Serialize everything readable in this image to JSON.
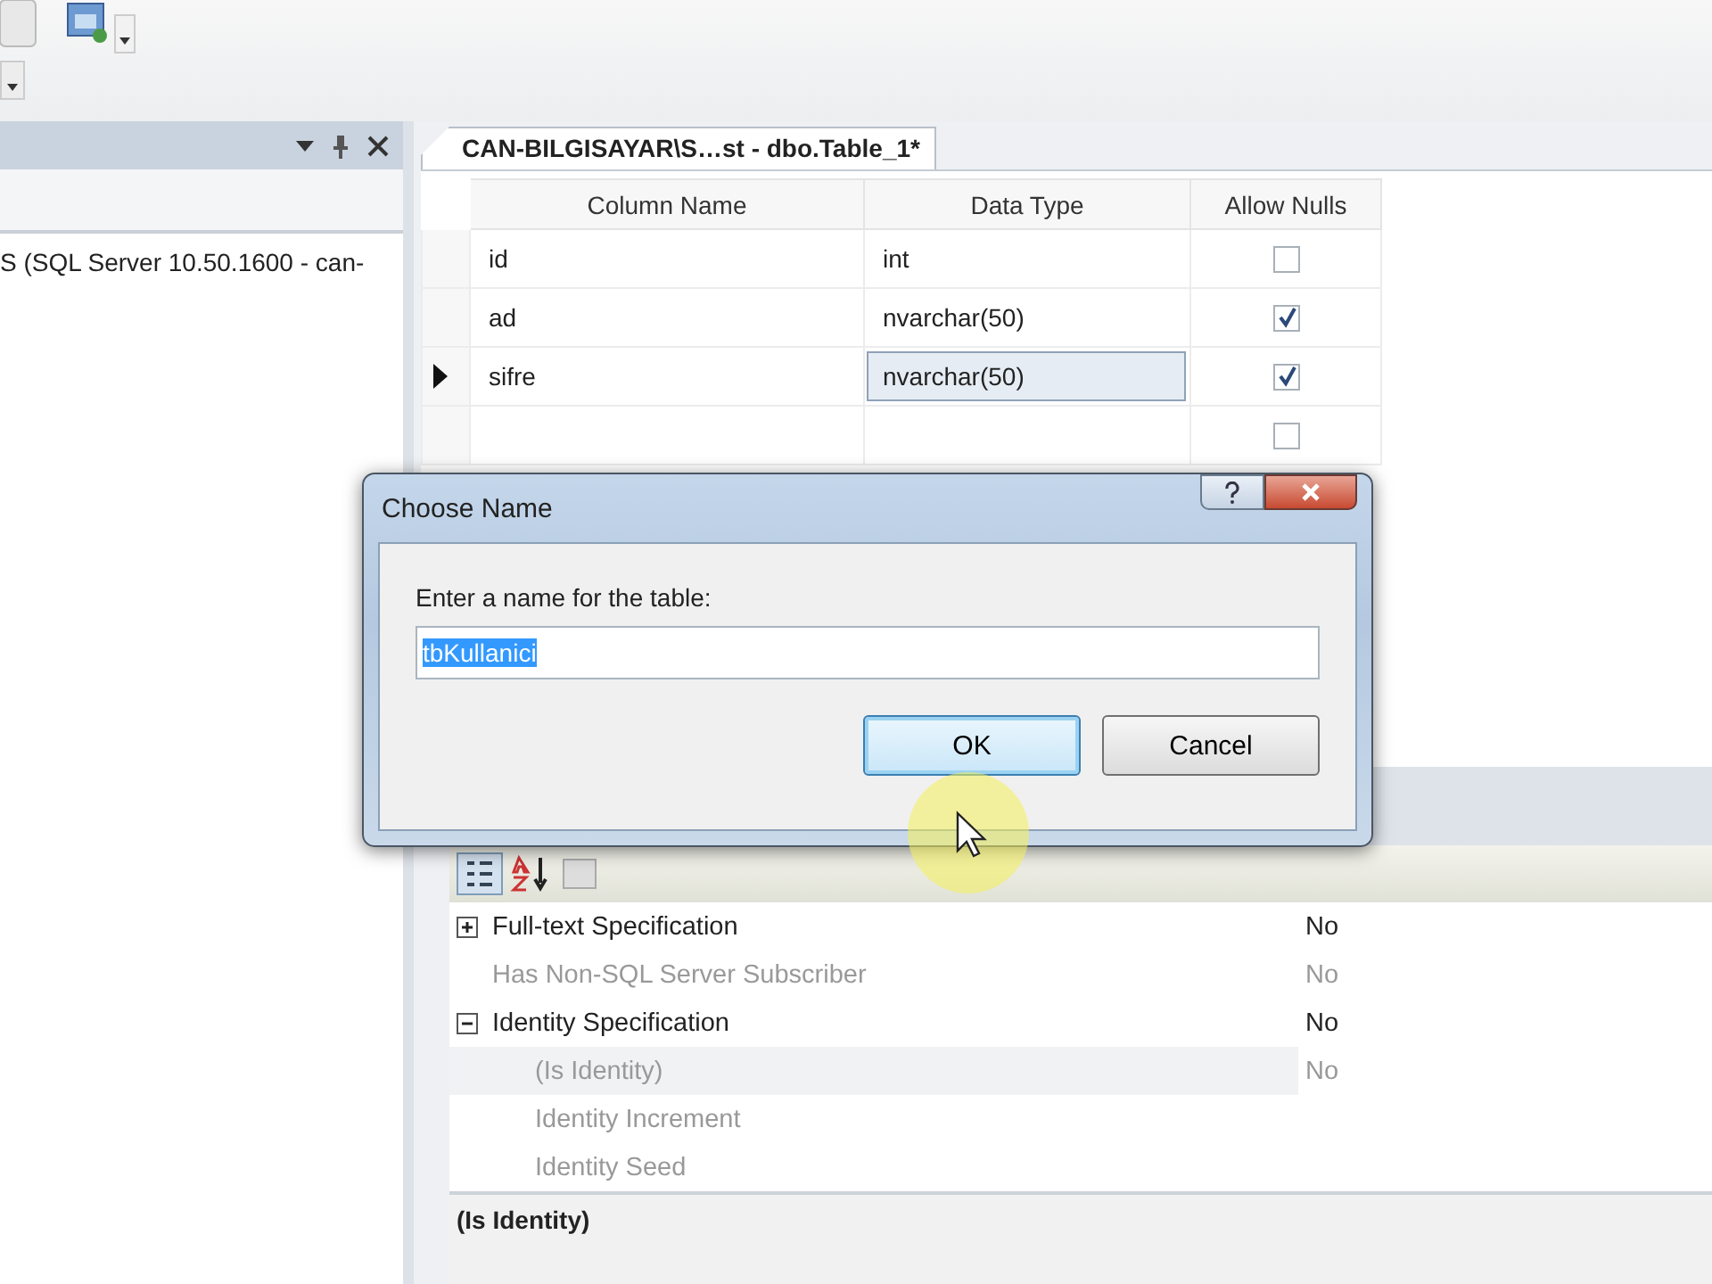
{
  "object_explorer": {
    "tree_item": "S (SQL Server 10.50.1600 - can-"
  },
  "document_tab": {
    "title": "CAN-BILGISAYAR\\S…st - dbo.Table_1*",
    "selected": true
  },
  "table_designer": {
    "columns": [
      "Column Name",
      "Data Type",
      "Allow Nulls"
    ],
    "rows": [
      {
        "column_name": "id",
        "data_type": "int",
        "allow_nulls": false,
        "current": false,
        "type_focused": false
      },
      {
        "column_name": "ad",
        "data_type": "nvarchar(50)",
        "allow_nulls": true,
        "current": false,
        "type_focused": false
      },
      {
        "column_name": "sifre",
        "data_type": "nvarchar(50)",
        "allow_nulls": true,
        "current": true,
        "type_focused": true
      },
      {
        "allow_nulls": false,
        "current": false
      }
    ]
  },
  "properties": {
    "rows": [
      {
        "name": "Full-text Specification",
        "value": "No",
        "expanded": false,
        "disabled": false,
        "selected": false
      },
      {
        "name": "Has Non-SQL Server Subscriber",
        "value": "No",
        "disabled": true,
        "selected": false
      },
      {
        "name": "Identity Specification",
        "value": "No",
        "expanded": true,
        "disabled": false,
        "selected": false,
        "children": [
          {
            "name": "(Is Identity)",
            "value": "No",
            "disabled": true,
            "selected": true
          },
          {
            "name": "Identity Increment",
            "disabled": true,
            "selected": false
          },
          {
            "name": "Identity Seed",
            "disabled": true,
            "selected": false
          }
        ]
      }
    ],
    "description": "(Is Identity)"
  },
  "dialog": {
    "title": "Choose Name",
    "label": "Enter a name for the table:",
    "value": "tbKullanici",
    "value_selected": true,
    "buttons": [
      {
        "label": "OK",
        "default": true
      },
      {
        "label": "Cancel",
        "default": false
      }
    ]
  }
}
